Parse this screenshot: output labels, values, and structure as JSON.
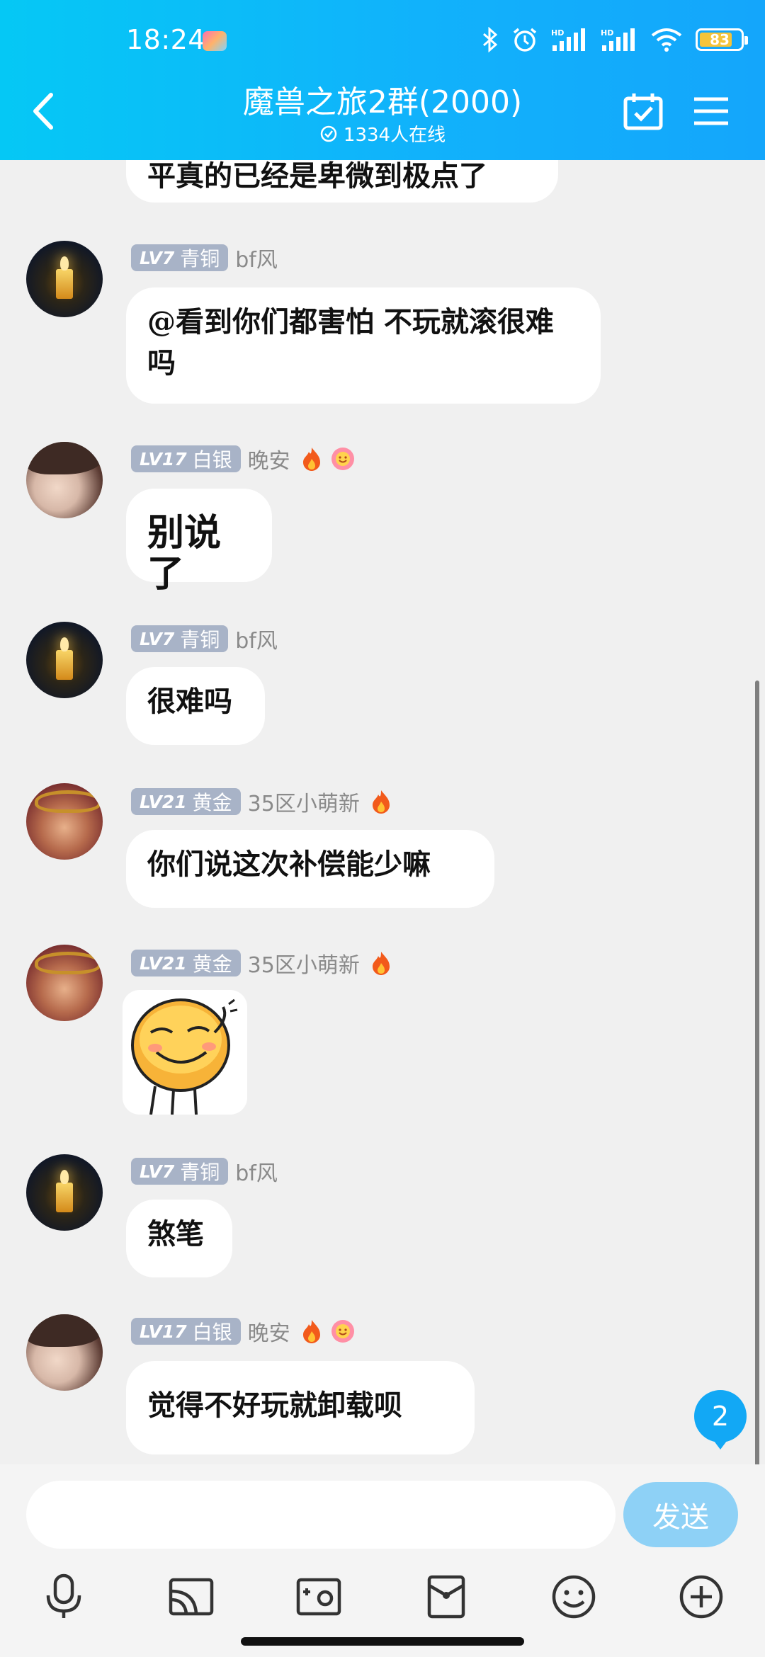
{
  "status_bar": {
    "time": "18:24",
    "battery": "83"
  },
  "header": {
    "title": "魔兽之旅2群(2000)",
    "online": "1334人在线"
  },
  "messages": [
    {
      "text": "平真的已经是卑微到极点了"
    },
    {
      "level": "LV7",
      "rank": "青铜",
      "nick": "bf风",
      "text": "@看到你们都害怕 不玩就滚很难吗"
    },
    {
      "level": "LV17",
      "rank": "白银",
      "nick": "晚安",
      "text": "别说了"
    },
    {
      "level": "LV7",
      "rank": "青铜",
      "nick": "bf风",
      "text": "很难吗"
    },
    {
      "level": "LV21",
      "rank": "黄金",
      "nick": "35区小萌新",
      "text": "你们说这次补偿能少嘛"
    },
    {
      "level": "LV21",
      "rank": "黄金",
      "nick": "35区小萌新",
      "sticker": "smiley-sticker"
    },
    {
      "level": "LV7",
      "rank": "青铜",
      "nick": "bf风",
      "text": "煞笔"
    },
    {
      "level": "LV17",
      "rank": "白银",
      "nick": "晚安",
      "text": "觉得不好玩就卸载呗"
    }
  ],
  "unread_count": "2",
  "input": {
    "placeholder": "",
    "send_label": "发送"
  },
  "toolbar": [
    "mic-icon",
    "cast-icon",
    "image-icon",
    "redpacket-icon",
    "emoji-icon",
    "plus-icon"
  ],
  "colors": {
    "header": "#11b2fb",
    "level_badge": "#a8b3c7",
    "send": "#8ed1f6",
    "unread": "#12a8f5"
  }
}
